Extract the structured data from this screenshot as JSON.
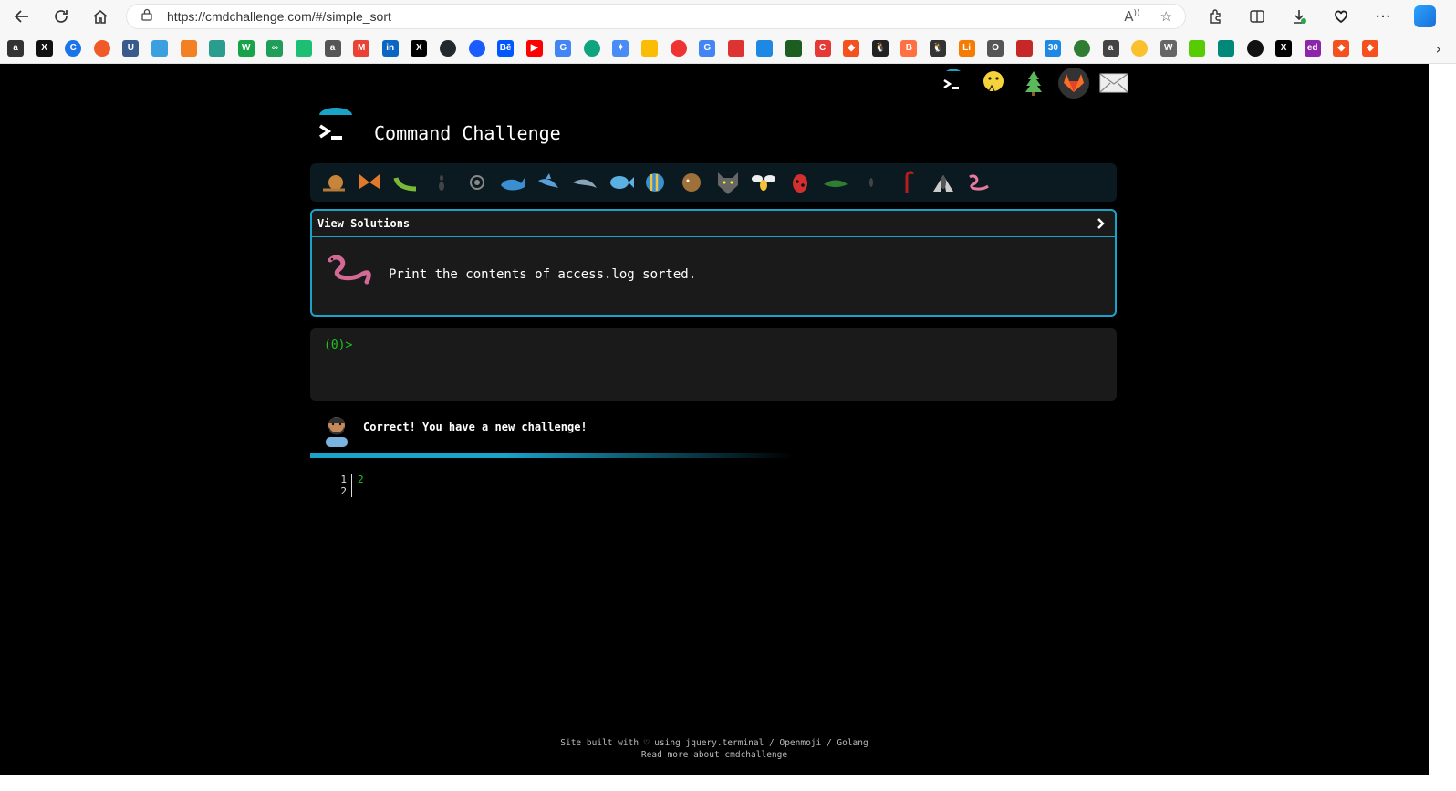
{
  "browser": {
    "url": "https://cmdchallenge.com/#/simple_sort",
    "bookmark_more": "›"
  },
  "page": {
    "title": "Command Challenge",
    "solutions_label": "View Solutions",
    "challenge_text": "Print the contents of access.log sorted.",
    "terminal_prompt": "(0)>",
    "message": "Correct! You have a new challenge!",
    "output_lines": [
      {
        "num": "1",
        "value": "2"
      },
      {
        "num": "2",
        "value": ""
      }
    ],
    "footer_line1": "Site built with ♡ using jquery.terminal / Openmoji / Golang",
    "footer_line2": "Read more about cmdchallenge"
  },
  "colors": {
    "accent": "#1aa3c9",
    "prompt_green": "#1ec41e",
    "background": "#000000"
  }
}
